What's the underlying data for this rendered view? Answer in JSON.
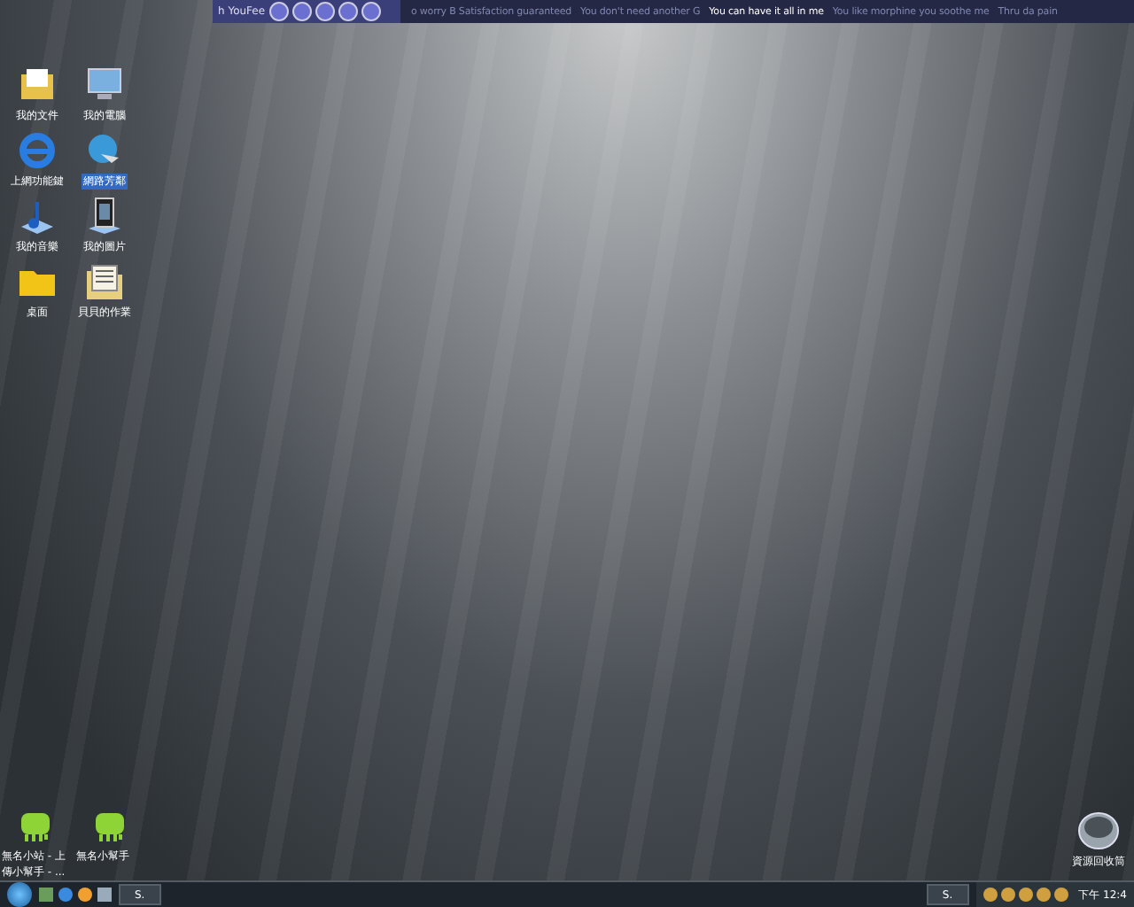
{
  "player": {
    "title": "h YouFee",
    "lyrics": [
      {
        "text": "o worry B Satisfaction guaranteed",
        "selected": false
      },
      {
        "text": "You don't need another G",
        "selected": false
      },
      {
        "text": "You can have it all in me",
        "selected": true
      },
      {
        "text": "You like morphine you soothe me",
        "selected": false
      },
      {
        "text": "Thru da pain",
        "selected": false
      }
    ]
  },
  "desktop_icons": [
    {
      "label": "我的文件",
      "kind": "documents",
      "selected": false
    },
    {
      "label": "我的電腦",
      "kind": "computer",
      "selected": false
    },
    {
      "label": "上網功能鍵",
      "kind": "browser",
      "selected": false
    },
    {
      "label": "網路芳鄰",
      "kind": "network",
      "selected": true
    },
    {
      "label": "我的音樂",
      "kind": "music",
      "selected": false
    },
    {
      "label": "我的圖片",
      "kind": "pictures",
      "selected": false
    },
    {
      "label": "桌面",
      "kind": "folder",
      "selected": false
    },
    {
      "label": "貝貝的作業",
      "kind": "docfolder",
      "selected": false
    }
  ],
  "bottom_icons": [
    {
      "label": "無名小站 - 上傳小幫手 - ...",
      "kind": "app",
      "selected": false
    },
    {
      "label": "無名小幫手",
      "kind": "app",
      "selected": false
    }
  ],
  "recycle_bin": {
    "label": "資源回收筒"
  },
  "taskbar": {
    "window_button": "S.",
    "tray_button": "S.",
    "clock": "下午 12:4"
  }
}
